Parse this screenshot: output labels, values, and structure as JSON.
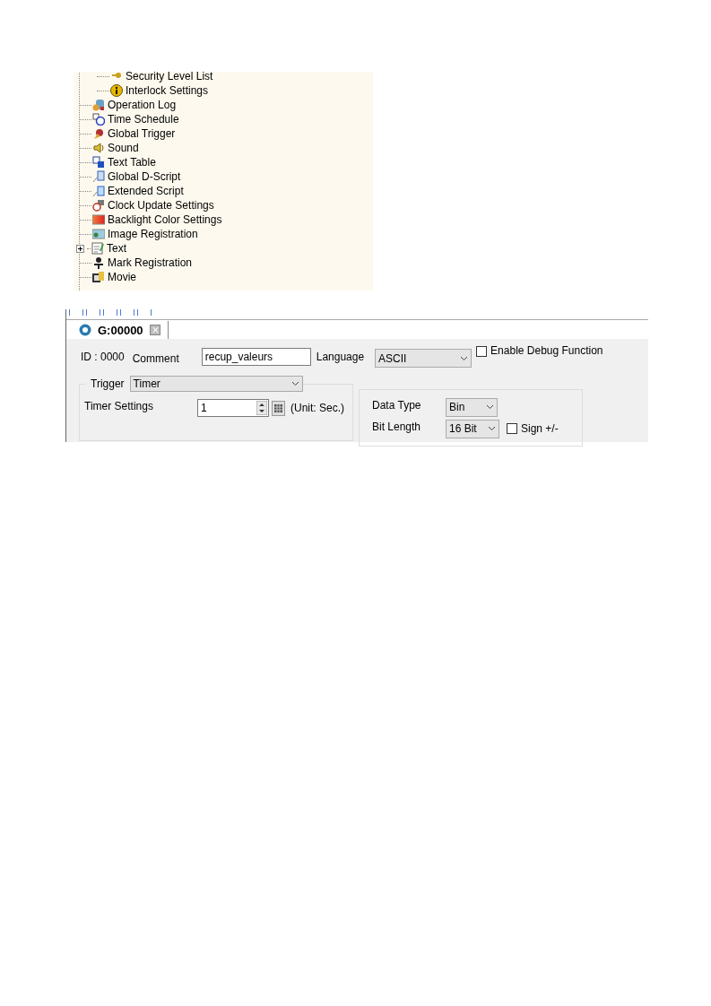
{
  "tree": {
    "items": [
      {
        "children": [
          {
            "label": "Security Level List"
          },
          {
            "label": "Interlock Settings"
          }
        ]
      },
      {
        "label": "Operation Log"
      },
      {
        "label": "Time Schedule"
      },
      {
        "label": "Global Trigger"
      },
      {
        "label": "Sound"
      },
      {
        "label": "Text Table"
      },
      {
        "label": "Global D-Script"
      },
      {
        "label": "Extended Script"
      },
      {
        "label": "Clock Update Settings"
      },
      {
        "label": "Backlight Color Settings"
      },
      {
        "label": "Image Registration"
      },
      {
        "label": "Text",
        "expanded": false
      },
      {
        "label": "Mark Registration"
      },
      {
        "label": "Movie"
      }
    ]
  },
  "editor": {
    "tab": {
      "label": "G:00000",
      "selected": true
    },
    "id": "ID : 0000",
    "comment_label": "Comment",
    "comment": "recup_valeurs",
    "language_label": "Language",
    "language": "ASCII",
    "debug": {
      "label": "Enable Debug Function",
      "checked": false
    },
    "trigger_label": "Trigger",
    "trigger": "Timer",
    "timer_label": "Timer Settings",
    "timer": "1",
    "unit": "(Unit: Sec.)",
    "data_type_label": "Data Type",
    "data_type": "Bin",
    "bit_length_label": "Bit Length",
    "bit_length": "16 Bit",
    "sign": {
      "label": "Sign +/-",
      "checked": false
    }
  }
}
